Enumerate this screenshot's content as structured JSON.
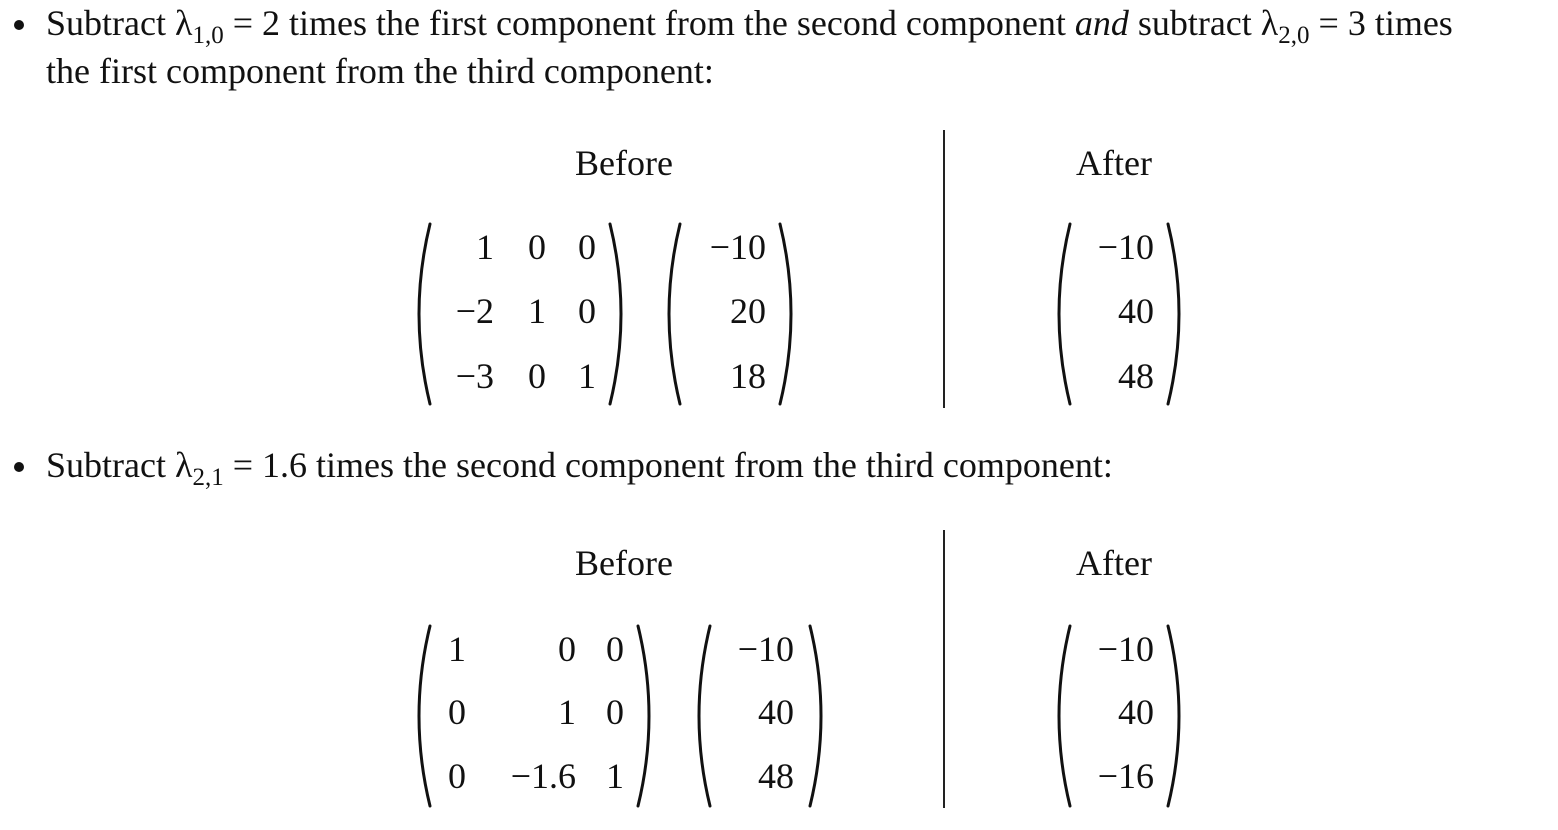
{
  "step1": {
    "text_a": "Subtract ",
    "lambda": "λ",
    "lambda1_sub": "1,0",
    "text_b": " = 2 times the first component from the second component ",
    "and_word": "and",
    "text_c": " subtract ",
    "lambda2_sub": "2,0",
    "text_d": " = 3 times",
    "line2": "the first component from the third component:",
    "before_label": "Before",
    "after_label": "After",
    "matrix": [
      [
        "1",
        "0",
        "0"
      ],
      [
        "−2",
        "1",
        "0"
      ],
      [
        "−3",
        "0",
        "1"
      ]
    ],
    "vector_before": [
      "−10",
      "20",
      "18"
    ],
    "vector_after": [
      "−10",
      "40",
      "48"
    ]
  },
  "step2": {
    "text_a": "Subtract ",
    "lambda": "λ",
    "lambda_sub": "2,1",
    "text_b": " = 1.6 times the second component from the third component:",
    "before_label": "Before",
    "after_label": "After",
    "matrix": [
      [
        "1",
        "0",
        "0"
      ],
      [
        "0",
        "1",
        "0"
      ],
      [
        "0",
        "−1.6",
        "1"
      ]
    ],
    "vector_before": [
      "−10",
      "40",
      "48"
    ],
    "vector_after": [
      "−10",
      "40",
      "−16"
    ]
  }
}
